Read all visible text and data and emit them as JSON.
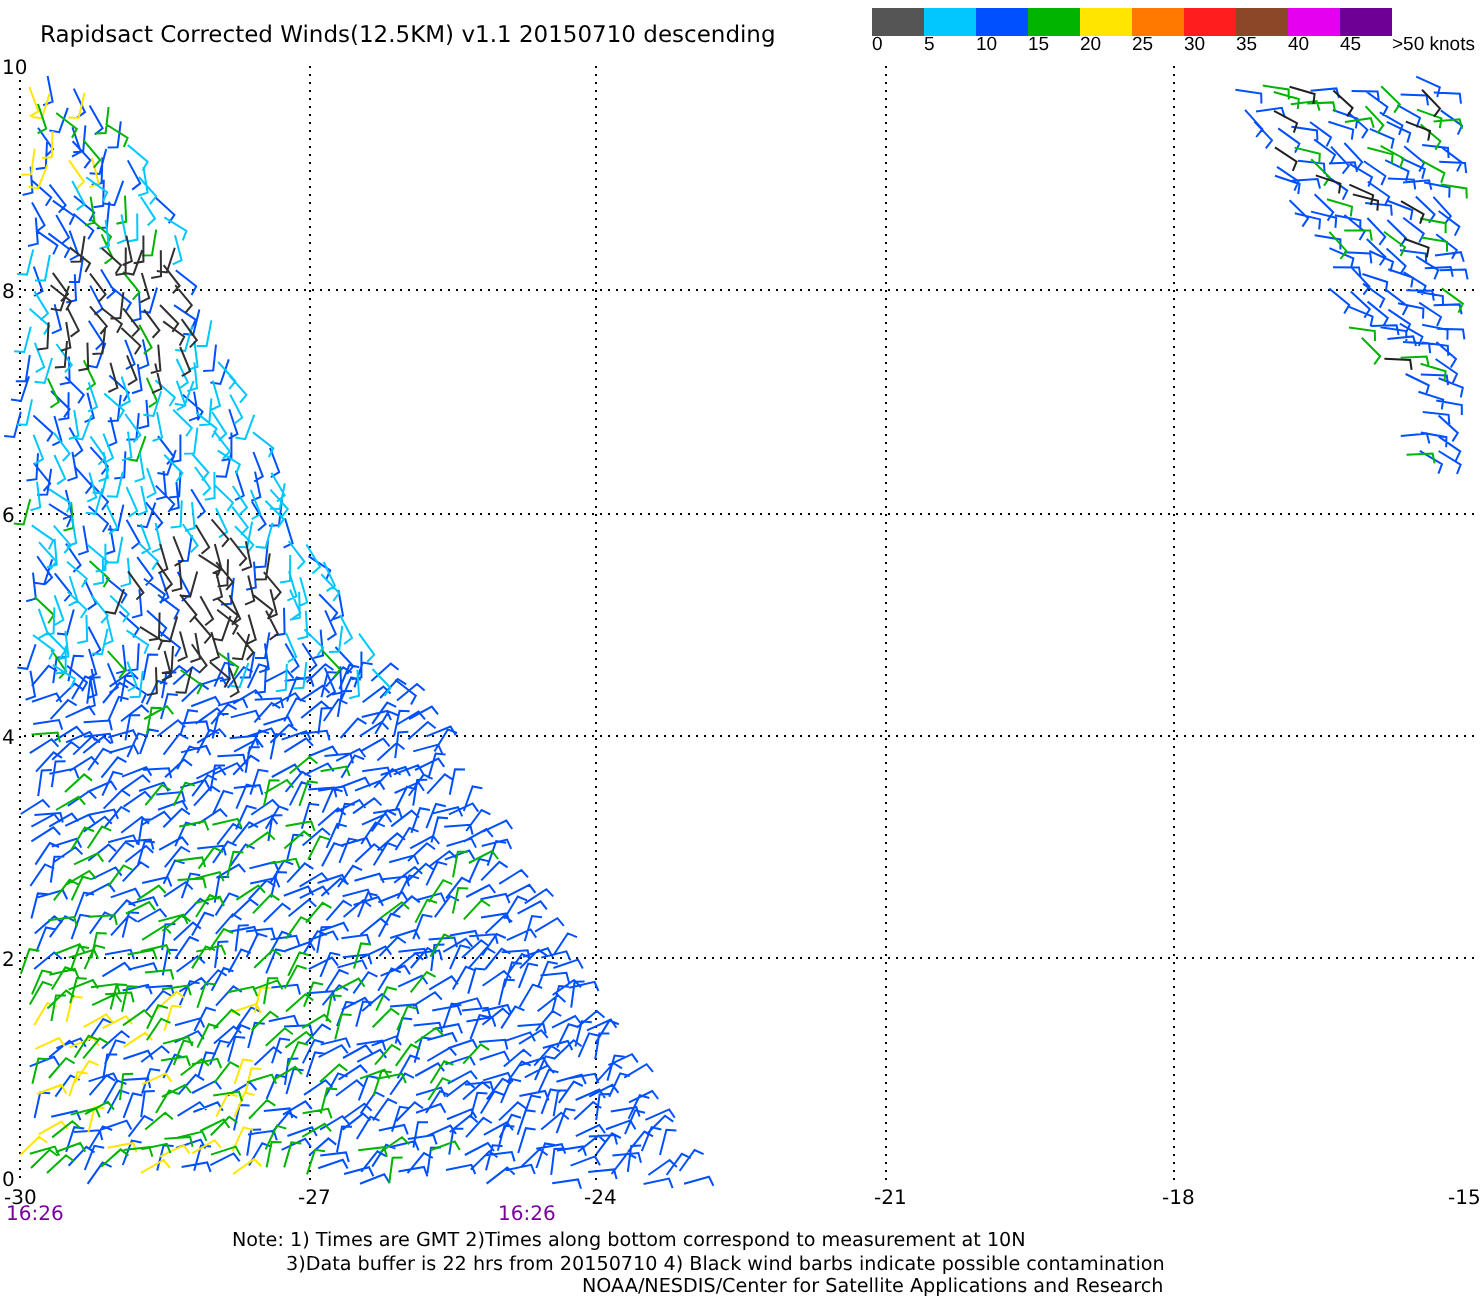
{
  "title": "Rapidsact Corrected Winds(12.5KM) v1.1 20150710 descending",
  "legend": {
    "segments": [
      {
        "color": "#555555"
      },
      {
        "color": "#00c8ff"
      },
      {
        "color": "#0050ff"
      },
      {
        "color": "#00b400"
      },
      {
        "color": "#ffe600"
      },
      {
        "color": "#ff7800"
      },
      {
        "color": "#ff1e1e"
      },
      {
        "color": "#8c4628"
      },
      {
        "color": "#e600f0"
      },
      {
        "color": "#6e0096"
      }
    ],
    "labels": [
      "0",
      "5",
      "10",
      "15",
      "20",
      "25",
      "30",
      "35",
      "40",
      "45",
      ">50 knots"
    ]
  },
  "map": {
    "y_labels": [
      "10",
      "8",
      "6",
      "4",
      "2",
      "0"
    ],
    "x_labels": [
      "-30",
      "-27",
      "-24",
      "-21",
      "-18",
      "-15"
    ],
    "time_labels": [
      "16:26",
      "16:26"
    ]
  },
  "notes": [
    "Note: 1) Times are GMT 2)Times along bottom correspond to measurement at 10N",
    "3)Data buffer is 22 hrs from 20150710 4) Black wind barbs indicate possible contamination",
    "NOAA/NESDIS/Center for Satellite Applications and Research"
  ]
}
